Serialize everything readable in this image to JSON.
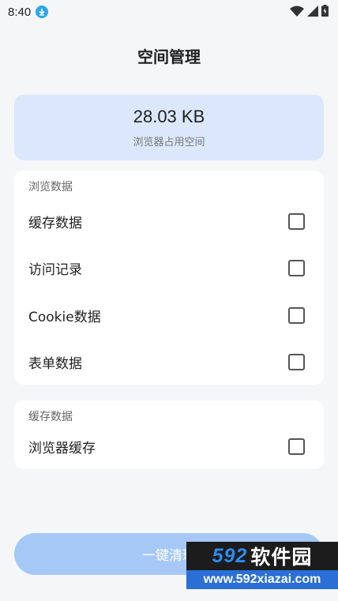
{
  "status_bar": {
    "time": "8:40",
    "download_icon": "download-arrow-icon",
    "wifi_icon": "wifi-icon",
    "signal_icon": "cellular-signal-icon",
    "battery_icon": "battery-charging-icon"
  },
  "header": {
    "title": "空间管理"
  },
  "storage": {
    "size": "28.03 KB",
    "label": "浏览器占用空间"
  },
  "browse_section": {
    "title": "浏览数据",
    "items": [
      {
        "label": "缓存数据",
        "checked": false
      },
      {
        "label": "访问记录",
        "checked": false
      },
      {
        "label": "Cookie数据",
        "checked": false
      },
      {
        "label": "表单数据",
        "checked": false
      }
    ]
  },
  "cache_section": {
    "title": "缓存数据",
    "items": [
      {
        "label": "浏览器缓存",
        "checked": false
      }
    ]
  },
  "clear_button": {
    "label": "一键清理"
  },
  "watermark": {
    "digits": "592",
    "brand": "软件园",
    "url": "www.592xiazai.com"
  },
  "colors": {
    "background": "#f5f6f8",
    "storage_card": "#dbe8fb",
    "clear_button": "#a6c8f7",
    "accent": "#2fa6e8"
  }
}
